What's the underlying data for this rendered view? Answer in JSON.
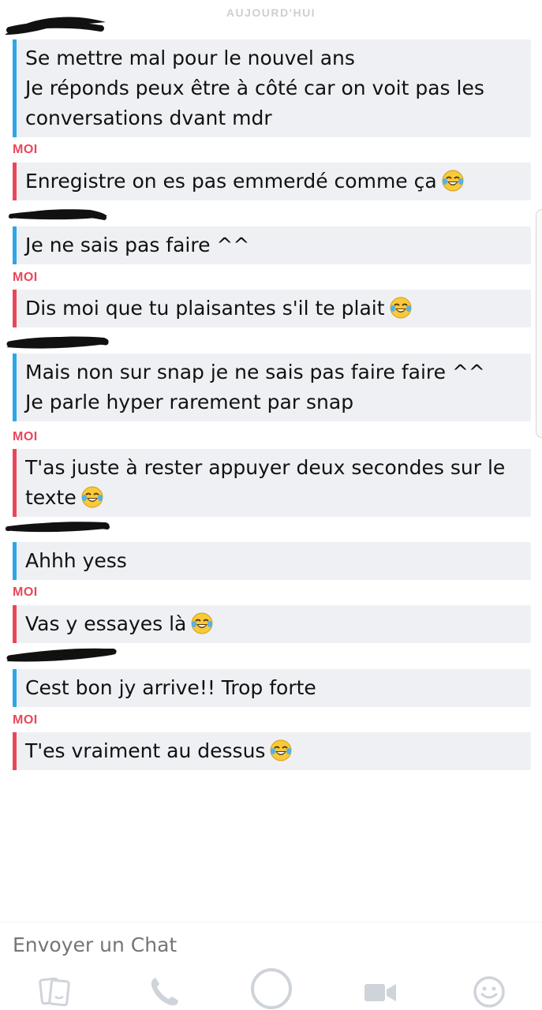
{
  "date_header": "AUJOURD'HUI",
  "me_label": "MOI",
  "messages": [
    {
      "from": "them",
      "lines": [
        "Se mettre mal pour le nouvel ans",
        "Je réponds peux être à côté car on voit pas les",
        "conversations dvant mdr"
      ]
    },
    {
      "from": "me",
      "lines": [
        "Enregistre on es pas emmerdé comme ça"
      ],
      "emoji": "tears-of-joy-emoji"
    },
    {
      "from": "them",
      "lines": [
        "Je ne sais pas faire ^^"
      ]
    },
    {
      "from": "me",
      "lines": [
        "Dis moi que tu plaisantes s'il te plait"
      ],
      "emoji": "tears-of-joy-emoji"
    },
    {
      "from": "them",
      "lines": [
        "Mais non sur snap je ne sais pas faire faire ^^",
        "Je parle hyper rarement par snap"
      ]
    },
    {
      "from": "me",
      "lines": [
        "T'as juste à rester appuyer deux secondes sur le",
        "texte"
      ],
      "emoji": "tears-of-joy-emoji"
    },
    {
      "from": "them",
      "lines": [
        "Ahhh yess"
      ]
    },
    {
      "from": "me",
      "lines": [
        "Vas y essayes là"
      ],
      "emoji": "tears-of-joy-emoji"
    },
    {
      "from": "them",
      "lines": [
        "Cest bon jy arrive!! Trop forte"
      ]
    },
    {
      "from": "me",
      "lines": [
        "T'es vraiment au dessus"
      ],
      "emoji": "tears-of-joy-emoji"
    }
  ],
  "compose": {
    "placeholder": "Envoyer un Chat"
  },
  "toolbar": [
    "stickers-icon",
    "phone-icon",
    "capture-button-icon",
    "video-call-icon",
    "emoji-icon"
  ],
  "colors": {
    "them_accent": "#2ea6e6",
    "me_accent": "#e8475a",
    "bubble_bg": "#eff0f3",
    "toolbar_icon": "#cfd3da"
  }
}
